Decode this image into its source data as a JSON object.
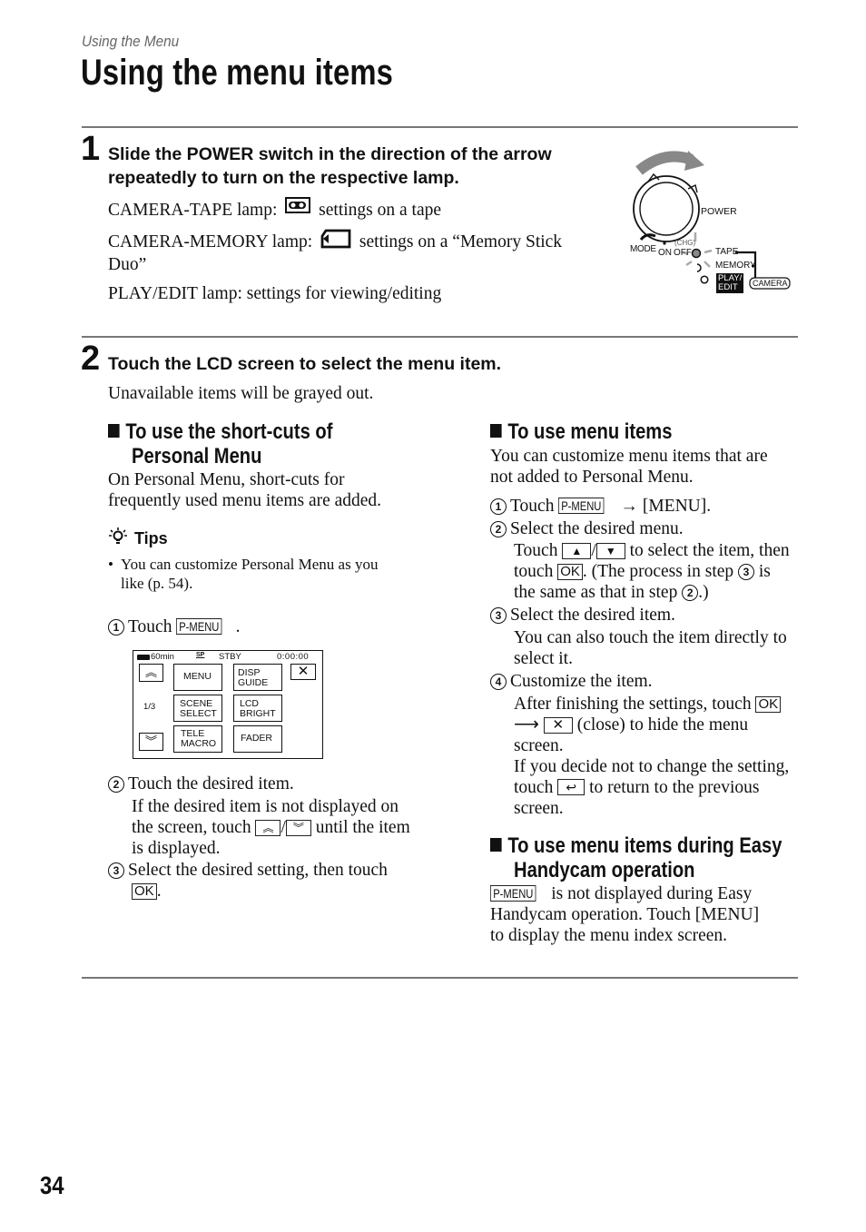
{
  "header": {
    "section_label": "Using the Menu",
    "page_title": "Using the menu items"
  },
  "step1": {
    "number": "1",
    "title_line1": "Slide the POWER switch in the direction of the arrow",
    "title_line2": "repeatedly to turn on the respective lamp.",
    "lamps": [
      {
        "prefix": "CAMERA-TAPE lamp:",
        "icon": "tape-icon",
        "suffix": "settings on a tape"
      },
      {
        "prefix": "CAMERA-MEMORY lamp:",
        "icon": "memory-stick-icon",
        "suffix": "settings on a “Memory Stick",
        "suffix2": "Duo”"
      },
      {
        "prefix": "PLAY/EDIT lamp: settings for viewing/editing"
      }
    ],
    "diagram": {
      "power": "POWER",
      "mode": "MODE",
      "on": "ON",
      "off": "OFF",
      "chg": "(CHG)",
      "tape": "TAPE",
      "memory": "MEMORY",
      "play": "PLAY/",
      "edit": "EDIT",
      "camera": "CAMERA"
    }
  },
  "step2": {
    "number": "2",
    "title": "Touch the LCD screen to select the menu item.",
    "note": "Unavailable items will be grayed out."
  },
  "left": {
    "heading_line1": "To use the short-cuts of",
    "heading_line2": "Personal Menu",
    "intro_line1": "On Personal Menu, short-cuts for",
    "intro_line2": "frequently used menu items are added.",
    "tips_label": "Tips",
    "tip_line1": "You can customize Personal Menu as you",
    "tip_line2": "like (p. 54).",
    "s1_num": "1",
    "s1_text": "Touch",
    "pmenu": "P-MENU",
    "s2_num": "2",
    "s2_text": "Touch the desired item.",
    "s2_detail_line1": "If the desired item is not displayed on",
    "s2_detail_a": "the screen, touch",
    "s2_detail_b": "until the item",
    "s2_detail_line3": "is displayed.",
    "s3_num": "3",
    "s3_text": "Select the desired setting, then touch",
    "ok": "OK"
  },
  "lcd": {
    "battery": "60min",
    "sp": "SP",
    "status": "STBY",
    "time": "0:00:00",
    "page": "1/3",
    "buttons": [
      {
        "l1": "MENU",
        "l2": ""
      },
      {
        "l1": "DISP",
        "l2": "GUIDE"
      },
      {
        "l1": "SCENE",
        "l2": "SELECT"
      },
      {
        "l1": "LCD",
        "l2": "BRIGHT"
      },
      {
        "l1": "TELE",
        "l2": "MACRO"
      },
      {
        "l1": "FADER",
        "l2": ""
      }
    ]
  },
  "right": {
    "heading": "To use menu items",
    "intro_line1": "You can customize menu items that are",
    "intro_line2": "not added to Personal Menu.",
    "s1_num": "1",
    "s1_a": "Touch",
    "s1_b": "→ [MENU].",
    "s2_num": "2",
    "s2_text": "Select the desired menu.",
    "s2_d1a": "Touch",
    "s2_d1b": "to select the item, then",
    "s2_d2a": "touch",
    "s2_d2b": ". (The process in step",
    "s2_d2c": "is",
    "s2_d3a": "the same as that in step",
    "s2_d3b": ".)",
    "s3_num": "3",
    "s3_text": "Select the desired item.",
    "s3_d1": "You can also touch the item directly to",
    "s3_d2": "select it.",
    "s4_num": "4",
    "s4_text": "Customize the item.",
    "s4_d1": "After finishing the settings, touch",
    "s4_d2": "(close) to hide the menu",
    "s4_d3": "screen.",
    "s4_d4": "If you decide not to change the setting,",
    "s4_d5a": "touch",
    "s4_d5b": "to return to the previous",
    "s4_d6": "screen.",
    "easy_heading_line1": "To use menu items during Easy",
    "easy_heading_line2": "Handycam operation",
    "easy_l1": "is not displayed during Easy",
    "easy_l2": "Handycam operation. Touch [MENU]",
    "easy_l3": "to display the menu index screen.",
    "ok": "OK",
    "pmenu": "P-MENU"
  },
  "footer": {
    "page_number": "34"
  }
}
